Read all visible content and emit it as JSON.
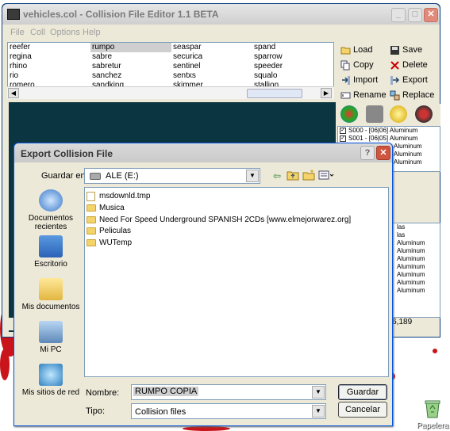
{
  "main_window": {
    "title": "vehicles.col - Collision File Editor 1.1 BETA",
    "menu": [
      "File",
      "Coll",
      "Options",
      "Help"
    ],
    "vehicle_columns": [
      [
        "reefer",
        "regina",
        "rhino",
        "rio",
        "romero"
      ],
      [
        "rumpo",
        "sabre",
        "sabretur",
        "sanchez",
        "sandking"
      ],
      [
        "seaspar",
        "securica",
        "sentinel",
        "sentxs",
        "skimmer"
      ],
      [
        "spand",
        "sparrow",
        "speeder",
        "squalo",
        "stallion"
      ]
    ],
    "selected_vehicle": "rumpo",
    "actions": {
      "load": "Load",
      "save": "Save",
      "copy": "Copy",
      "delete": "Delete",
      "import": "Import",
      "export": "Export",
      "rename": "Rename",
      "replace": "Replace"
    },
    "collision_rows": [
      "S000 - [06|06] Aluminum",
      "S001 - [06|05] Aluminum",
      "Aluminum",
      "Aluminum",
      "Aluminum"
    ],
    "lower_rows": [
      "las",
      "las",
      "Aluminum",
      "Aluminum",
      "Aluminum",
      "Aluminum",
      "Aluminum",
      "Aluminum",
      "Aluminum"
    ],
    "status_text": "n: 6,189"
  },
  "desktop": {
    "recycle_bin_label": "Papelera"
  },
  "dialog": {
    "title": "Export Collision File",
    "save_in_label": "Guardar en:",
    "save_in_value": "ALE (E:)",
    "places": [
      "Documentos recientes",
      "Escritorio",
      "Mis documentos",
      "Mi PC",
      "Mis sitios de red"
    ],
    "files": [
      {
        "name": "msdownld.tmp",
        "kind": "folder"
      },
      {
        "name": "Musica",
        "kind": "folder"
      },
      {
        "name": "Need For Speed Underground SPANISH 2CDs [www.elmejorwarez.org]",
        "kind": "folder"
      },
      {
        "name": "Peliculas",
        "kind": "folder"
      },
      {
        "name": "WUTemp",
        "kind": "folder"
      }
    ],
    "name_label": "Nombre:",
    "name_value": "RUMPO COPIA",
    "type_label": "Tipo:",
    "type_value": "Collision files",
    "save_button": "Guardar",
    "cancel_button": "Cancelar"
  }
}
